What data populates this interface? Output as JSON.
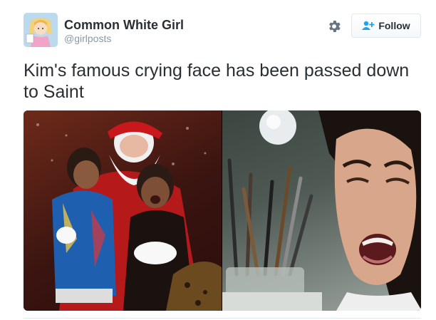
{
  "tweet": {
    "author_name": "Common White Girl",
    "author_handle": "@girlposts",
    "text": "Kim's famous crying face has been passed down to Saint",
    "follow_label": "Follow"
  },
  "icons": {
    "settings": "gear-icon",
    "follow": "add-user-icon",
    "avatar": "cartoon-princess-avatar"
  },
  "colors": {
    "name_text": "#292f33",
    "handle_text": "#8899a6",
    "follow_icon": "#1da1f2",
    "border": "#e1e8ed"
  },
  "media": {
    "photos": [
      {
        "name": "santa-photo"
      },
      {
        "name": "crying-woman-photo"
      }
    ]
  }
}
